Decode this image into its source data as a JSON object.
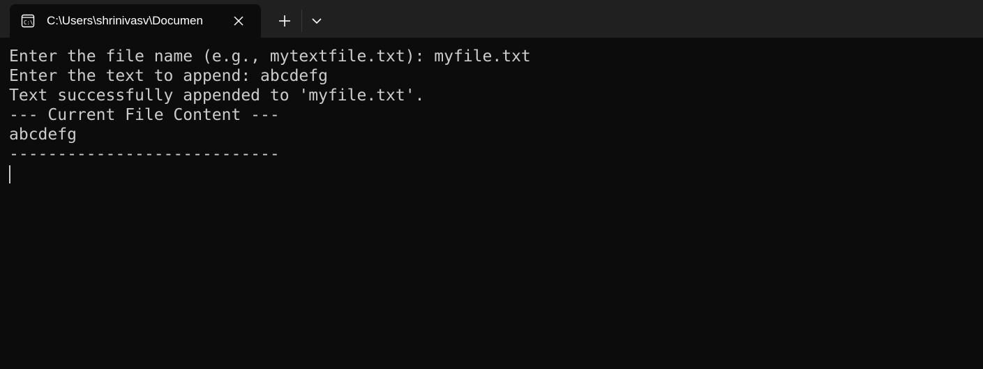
{
  "window": {
    "tab_title": "C:\\Users\\shrinivasv\\Documen",
    "tab_icon": "console-icon",
    "close_icon": "close-icon",
    "new_tab_icon": "plus-icon",
    "dropdown_icon": "chevron-down-icon",
    "colors": {
      "titlebar": "#202020",
      "terminal_bg": "#0c0c0c",
      "text": "#cccccc"
    }
  },
  "terminal": {
    "lines": [
      "Enter the file name (e.g., mytextfile.txt): myfile.txt",
      "Enter the text to append: abcdefg",
      "Text successfully appended to 'myfile.txt'.",
      "--- Current File Content ---",
      "abcdefg",
      "----------------------------"
    ]
  }
}
